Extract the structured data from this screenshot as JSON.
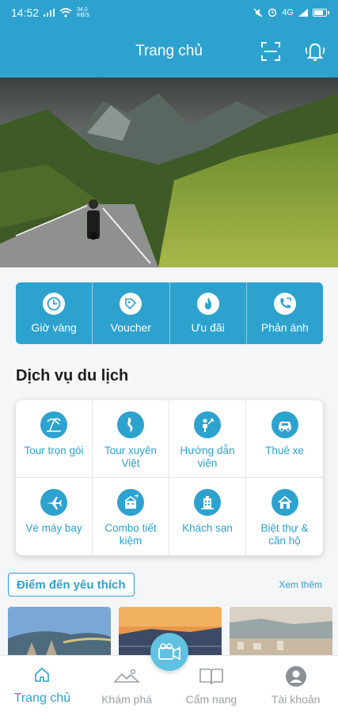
{
  "status_bar": {
    "time": "14:52",
    "network": "4G",
    "speed": "34,0 KB/S"
  },
  "header": {
    "title": "Trang chủ"
  },
  "quick_actions": [
    {
      "label": "Giờ vàng",
      "icon": "clock-icon"
    },
    {
      "label": "Voucher",
      "icon": "voucher-icon"
    },
    {
      "label": "Ưu đãi",
      "icon": "fire-icon"
    },
    {
      "label": "Phản ánh",
      "icon": "phone-feedback-icon"
    }
  ],
  "services": {
    "title": "Dịch vụ du lịch",
    "items": [
      {
        "label": "Tour trọn gói",
        "icon": "beach-icon"
      },
      {
        "label": "Tour xuyên Việt",
        "icon": "vietnam-map-icon"
      },
      {
        "label": "Hướng dẫn viên",
        "icon": "guide-icon"
      },
      {
        "label": "Thuê xe",
        "icon": "car-icon"
      },
      {
        "label": "Vé máy bay",
        "icon": "airplane-icon"
      },
      {
        "label": "Combo tiết kiệm",
        "icon": "combo-icon"
      },
      {
        "label": "Khách sạn",
        "icon": "hotel-icon"
      },
      {
        "label": "Biệt thự & căn hộ",
        "icon": "villa-icon"
      }
    ]
  },
  "favorites": {
    "title": "Điểm đến yêu thích",
    "see_more": "Xem thêm"
  },
  "bottom_nav": [
    {
      "label": "Trang chủ",
      "icon": "home-icon",
      "active": true
    },
    {
      "label": "Khám phá",
      "icon": "explore-icon",
      "active": false
    },
    {
      "label": "Cẩm nang",
      "icon": "book-icon",
      "active": false
    },
    {
      "label": "Tài khoản",
      "icon": "account-icon",
      "active": false
    }
  ],
  "colors": {
    "primary": "#2ea2cf",
    "fab": "#5ec2e0",
    "inactive": "#9aa0a6"
  }
}
